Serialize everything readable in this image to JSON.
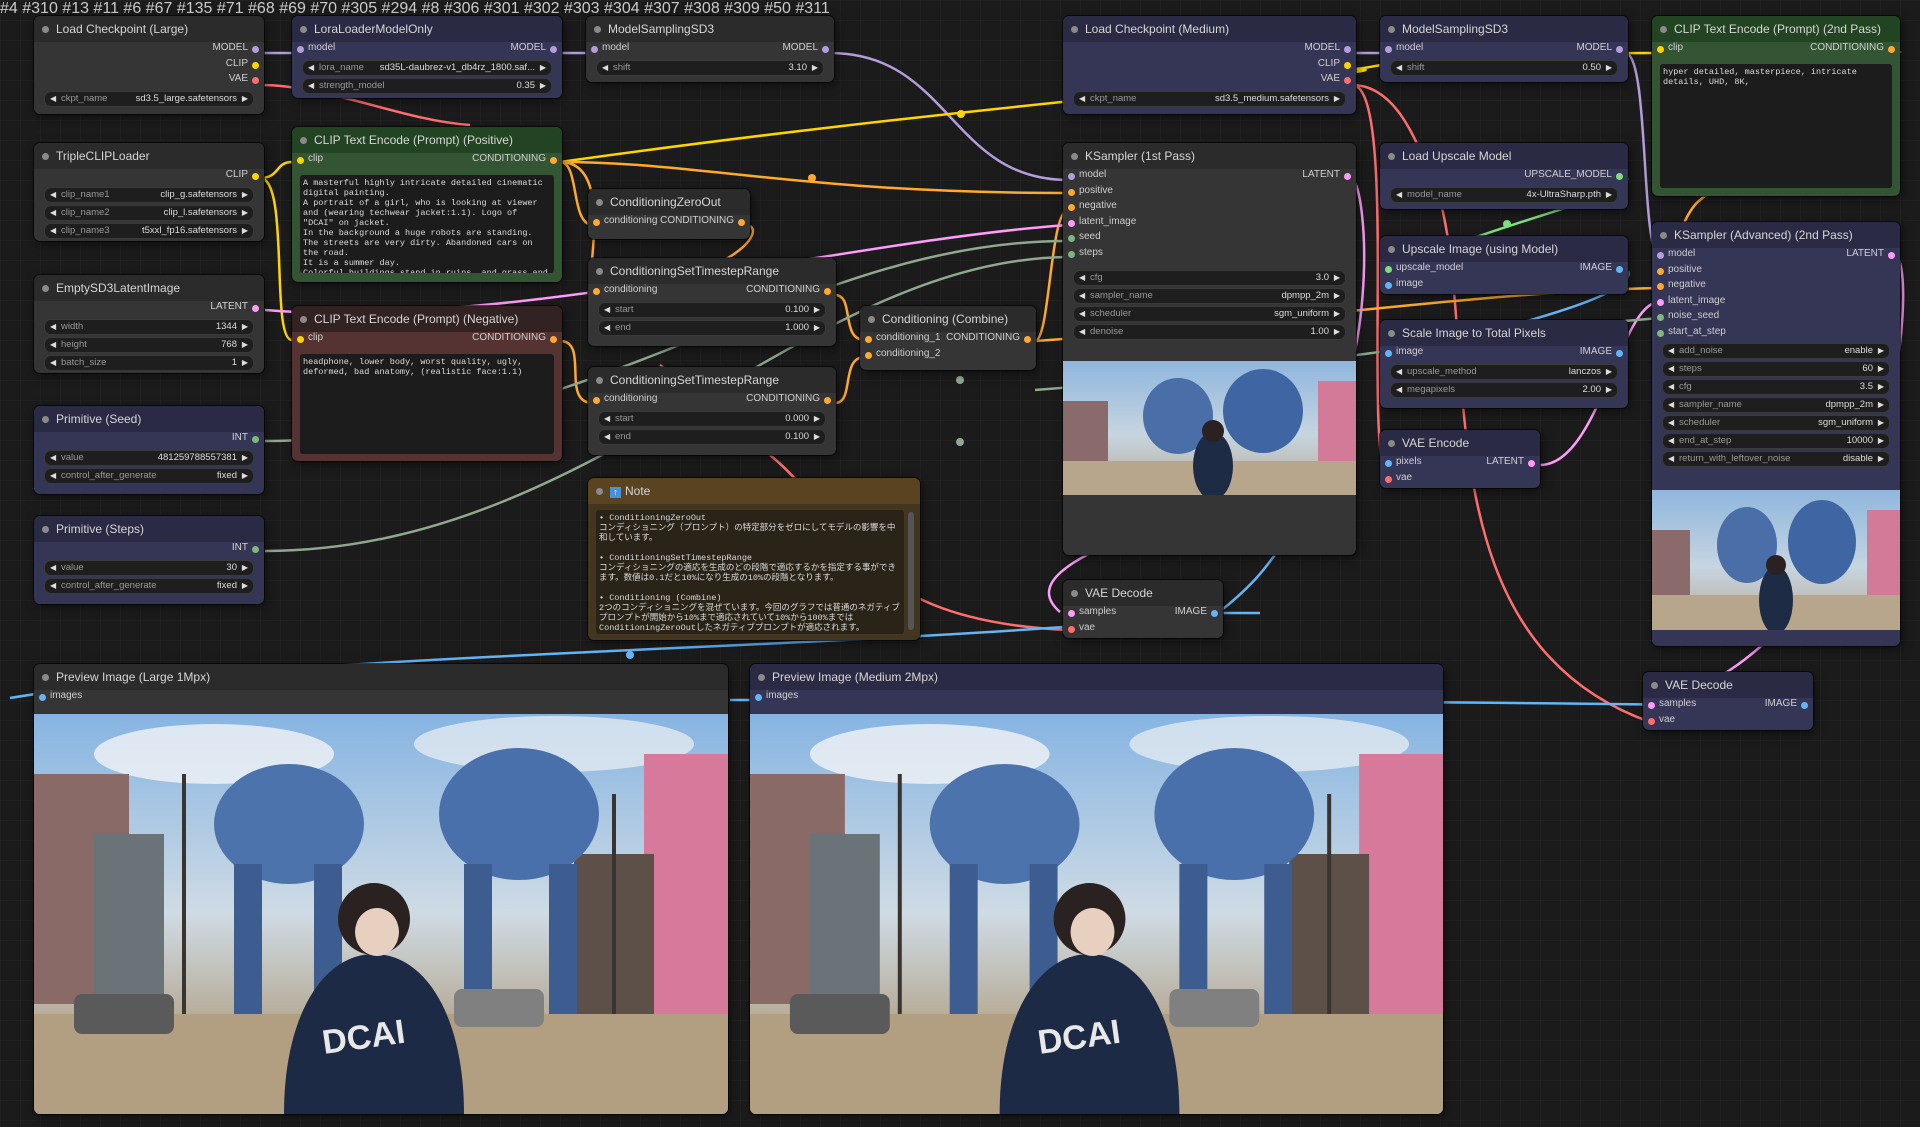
{
  "nodes": {
    "ckpt_large": {
      "id": "#4",
      "title": "Load Checkpoint (Large)",
      "out": [
        "MODEL",
        "CLIP",
        "VAE"
      ],
      "w_key": "ckpt_name",
      "w_val": "sd3.5_large.safetensors"
    },
    "lora": {
      "id": "#310",
      "title": "LoraLoaderModelOnly",
      "in": "model",
      "out": "MODEL",
      "w1_key": "lora_name",
      "w1_val": "sd35L-daubrez-v1_db4rz_1800.saf...",
      "w2_key": "strength_model",
      "w2_val": "0.35"
    },
    "msd3_a": {
      "id": "#13",
      "title": "ModelSamplingSD3",
      "in": "model",
      "out": "MODEL",
      "w_key": "shift",
      "w_val": "3.10"
    },
    "tripleclip": {
      "id": "#11",
      "title": "TripleCLIPLoader",
      "out": "CLIP",
      "w": [
        {
          "k": "clip_name1",
          "v": "clip_g.safetensors"
        },
        {
          "k": "clip_name2",
          "v": "clip_l.safetensors"
        },
        {
          "k": "clip_name3",
          "v": "t5xxl_fp16.safetensors"
        }
      ]
    },
    "clip_pos": {
      "id": "#6",
      "title": "CLIP Text Encode (Prompt) (Positive)",
      "in": "clip",
      "out": "CONDITIONING",
      "text": "A masterful highly intricate detailed cinematic digital painting.\nA portrait of a girl, who is looking at viewer and (wearing techwear jacket:1.1). Logo of \"DCAI\" on jacket.\nIn the background a huge robots are standing.\nThe streets are very dirty. Abandoned cars on the road.\nIt is a summer day.\nColorful buildings stand in ruins, and grass and trees grow everywhere."
    },
    "czo": {
      "id": "#67",
      "title": "ConditioningZeroOut",
      "in": "conditioning",
      "out": "CONDITIONING"
    },
    "empty_latent": {
      "id": "#135",
      "title": "EmptySD3LatentImage",
      "out": "LATENT",
      "w": [
        {
          "k": "width",
          "v": "1344"
        },
        {
          "k": "height",
          "v": "768"
        },
        {
          "k": "batch_size",
          "v": "1"
        }
      ]
    },
    "clip_neg": {
      "id": "#71",
      "title": "CLIP Text Encode (Prompt) (Negative)",
      "in": "clip",
      "out": "CONDITIONING",
      "text": "headphone, lower body, worst quality, ugly, deformed, bad anatomy, (realistic face:1.1)"
    },
    "cstr1": {
      "id": "#68",
      "title": "ConditioningSetTimestepRange",
      "in": "conditioning",
      "out": "CONDITIONING",
      "w1_key": "start",
      "w1_val": "0.100",
      "w2_key": "end",
      "w2_val": "1.000"
    },
    "ccomb": {
      "id": "#69",
      "title": "Conditioning (Combine)",
      "in1": "conditioning_1",
      "in2": "conditioning_2",
      "out": "CONDITIONING"
    },
    "cstr2": {
      "id": "#70",
      "title": "ConditioningSetTimestepRange",
      "in": "conditioning",
      "out": "CONDITIONING",
      "w1_key": "start",
      "w1_val": "0.000",
      "w2_key": "end",
      "w2_val": "0.100"
    },
    "prim_seed": {
      "title": "Primitive (Seed)",
      "out": "INT",
      "w1_key": "value",
      "w1_val": "481259788557381",
      "w2_key": "control_after_generate",
      "w2_val": "fixed"
    },
    "prim_steps": {
      "title": "Primitive (Steps)",
      "out": "INT",
      "w1_key": "value",
      "w1_val": "30",
      "w2_key": "control_after_generate",
      "w2_val": "fixed"
    },
    "note": {
      "title": "Note",
      "text": "• ConditioningZeroOut\nコンディショニング（プロンプト）の特定部分をゼロにしてモデルの影響を中和しています。\n\n• ConditioningSetTimestepRange\nコンディショニングの適応を生成のどの段階で適応するかを指定する事ができます。数値は0.1だと10%になり生成の10%の段階となります。\n\n• Conditioning (Combine)\n2つのコンディショニングを混ぜています。今回のグラフでは普通のネガティブプロンプトが開始から10%まで適応されていて10%から100%まではConditioningZeroOutしたネガティブプロンプトが適応されます。"
    },
    "ckpt_med": {
      "id": "#305",
      "title": "Load Checkpoint (Medium)",
      "out": [
        "MODEL",
        "CLIP",
        "VAE"
      ],
      "w_key": "ckpt_name",
      "w_val": "sd3.5_medium.safetensors"
    },
    "ksampler1": {
      "id": "#294",
      "title": "KSampler (1st Pass)",
      "ins": [
        "model",
        "positive",
        "negative",
        "latent_image",
        "seed",
        "steps"
      ],
      "out": "LATENT",
      "w": [
        {
          "k": "cfg",
          "v": "3.0"
        },
        {
          "k": "sampler_name",
          "v": "dpmpp_2m"
        },
        {
          "k": "scheduler",
          "v": "sgm_uniform"
        },
        {
          "k": "denoise",
          "v": "1.00"
        }
      ]
    },
    "vaedec1": {
      "id": "#8",
      "title": "VAE Decode",
      "in1": "samples",
      "in2": "vae",
      "out": "IMAGE"
    },
    "msd3_b": {
      "id": "#306",
      "title": "ModelSamplingSD3",
      "in": "model",
      "out": "MODEL",
      "w_key": "shift",
      "w_val": "0.50"
    },
    "upscale_loader": {
      "id": "#301",
      "title": "Load Upscale Model",
      "out": "UPSCALE_MODEL",
      "w_key": "model_name",
      "w_val": "4x-UltraSharp.pth"
    },
    "upscale_img": {
      "id": "#302",
      "title": "Upscale Image (using Model)",
      "in1": "upscale_model",
      "in2": "image",
      "out": "IMAGE"
    },
    "scale_px": {
      "id": "#303",
      "title": "Scale Image to Total Pixels",
      "in": "image",
      "out": "IMAGE",
      "w1_key": "upscale_method",
      "w1_val": "lanczos",
      "w2_key": "megapixels",
      "w2_val": "2.00"
    },
    "vaeenc": {
      "id": "#304",
      "title": "VAE Encode",
      "in1": "pixels",
      "in2": "vae",
      "out": "LATENT"
    },
    "clip2": {
      "id": "#307",
      "title": "CLIP Text Encode (Prompt) (2nd Pass)",
      "in": "clip",
      "out": "CONDITIONING",
      "text": "hyper detailed, masterpiece, intricate details, UHD, 8K,"
    },
    "ksampler2": {
      "id": "#308",
      "title": "KSampler (Advanced) (2nd Pass)",
      "ins": [
        "model",
        "positive",
        "negative",
        "latent_image",
        "noise_seed",
        "start_at_step"
      ],
      "out": "LATENT",
      "w": [
        {
          "k": "add_noise",
          "v": "enable"
        },
        {
          "k": "steps",
          "v": "60"
        },
        {
          "k": "cfg",
          "v": "3.5"
        },
        {
          "k": "sampler_name",
          "v": "dpmpp_2m"
        },
        {
          "k": "scheduler",
          "v": "sgm_uniform"
        },
        {
          "k": "end_at_step",
          "v": "10000"
        },
        {
          "k": "return_with_leftover_noise",
          "v": "disable"
        }
      ]
    },
    "vaedec2": {
      "id": "#309",
      "title": "VAE Decode",
      "in1": "samples",
      "in2": "vae",
      "out": "IMAGE"
    },
    "prev_large": {
      "id": "#50",
      "title": "Preview Image (Large 1Mpx)",
      "in": "images"
    },
    "prev_med": {
      "id": "#311",
      "title": "Preview Image (Medium 2Mpx)",
      "in": "images"
    }
  },
  "colors": {
    "model": "#b39ddb",
    "clip": "#ffd500",
    "vae": "#ff6e6e",
    "conditioning": "#ffa931",
    "latent": "#ff9cf9",
    "image": "#64b5f6",
    "int": "#7fb77f",
    "upscale": "#7fdf7f"
  }
}
